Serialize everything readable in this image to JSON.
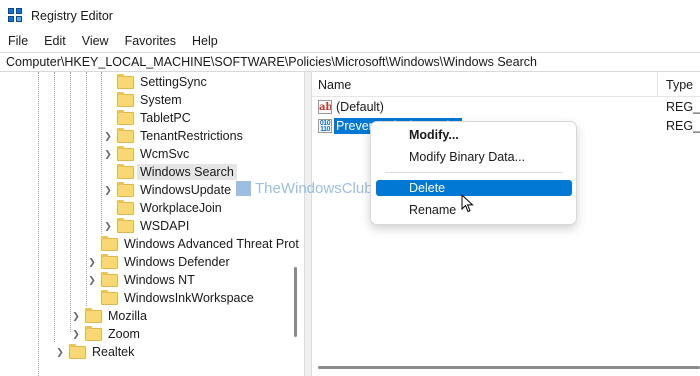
{
  "window": {
    "title": "Registry Editor",
    "accent": "#0078d4"
  },
  "menu": [
    "File",
    "Edit",
    "View",
    "Favorites",
    "Help"
  ],
  "address": "Computer\\HKEY_LOCAL_MACHINE\\SOFTWARE\\Policies\\Microsoft\\Windows\\Windows Search",
  "tree": {
    "items": [
      {
        "label": "SettingSync",
        "expandable": false
      },
      {
        "label": "System",
        "expandable": false
      },
      {
        "label": "TabletPC",
        "expandable": false
      },
      {
        "label": "TenantRestrictions",
        "expandable": true
      },
      {
        "label": "WcmSvc",
        "expandable": true
      },
      {
        "label": "Windows Search",
        "expandable": false,
        "selected": true
      },
      {
        "label": "WindowsUpdate",
        "expandable": true
      },
      {
        "label": "WorkplaceJoin",
        "expandable": false
      },
      {
        "label": "WSDAPI",
        "expandable": true
      },
      {
        "label": "Windows Advanced Threat Prot",
        "expandable": false
      },
      {
        "label": "Windows Defender",
        "expandable": true
      },
      {
        "label": "Windows NT",
        "expandable": true
      },
      {
        "label": "WindowsInkWorkspace",
        "expandable": false
      },
      {
        "label": "Mozilla",
        "expandable": true
      },
      {
        "label": "Zoom",
        "expandable": true
      },
      {
        "label": "Realtek",
        "expandable": true
      }
    ]
  },
  "list": {
    "columns": {
      "name": "Name",
      "type": "Type"
    },
    "rows": [
      {
        "name": "(Default)",
        "type": "REG_SZ",
        "icon": "string-value-icon"
      },
      {
        "name": "PreventIndexingOutlook",
        "type": "REG_DWORD",
        "icon": "binary-value-icon",
        "selected": true
      }
    ]
  },
  "context_menu": {
    "items": [
      "Modify...",
      "Modify Binary Data...",
      "Delete",
      "Rename"
    ],
    "highlighted": "Delete"
  },
  "watermark": "TheWindowsClub"
}
